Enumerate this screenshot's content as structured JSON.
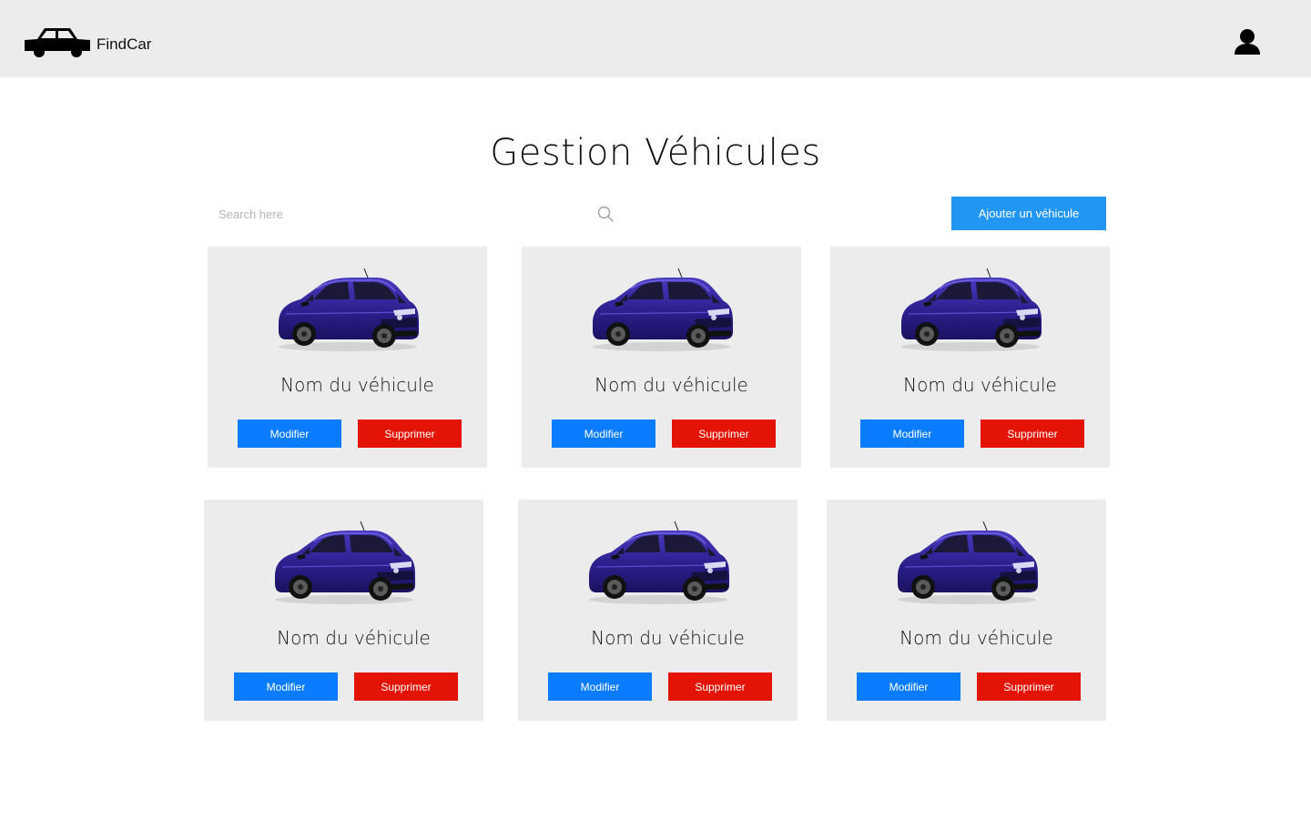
{
  "app": {
    "brand": "FindCar",
    "logo_icon": "car-icon",
    "user_icon": "user-icon"
  },
  "page": {
    "title": "Gestion Véhicules"
  },
  "search": {
    "placeholder": "Search here",
    "value": "",
    "icon": "search-icon"
  },
  "actions": {
    "add_label": "Ajouter un véhicule"
  },
  "colors": {
    "header_bg": "#ececec",
    "card_bg": "#ececec",
    "primary": "#2196f3",
    "edit": "#0a7cff",
    "delete": "#e31305",
    "car_body": "#2b1f8c"
  },
  "vehicles": [
    {
      "name": "Nom du véhicule",
      "edit_label": "Modifier",
      "delete_label": "Supprimer"
    },
    {
      "name": "Nom du véhicule",
      "edit_label": "Modifier",
      "delete_label": "Supprimer"
    },
    {
      "name": "Nom du véhicule",
      "edit_label": "Modifier",
      "delete_label": "Supprimer"
    },
    {
      "name": "Nom du véhicule",
      "edit_label": "Modifier",
      "delete_label": "Supprimer"
    },
    {
      "name": "Nom du véhicule",
      "edit_label": "Modifier",
      "delete_label": "Supprimer"
    },
    {
      "name": "Nom du véhicule",
      "edit_label": "Modifier",
      "delete_label": "Supprimer"
    }
  ]
}
